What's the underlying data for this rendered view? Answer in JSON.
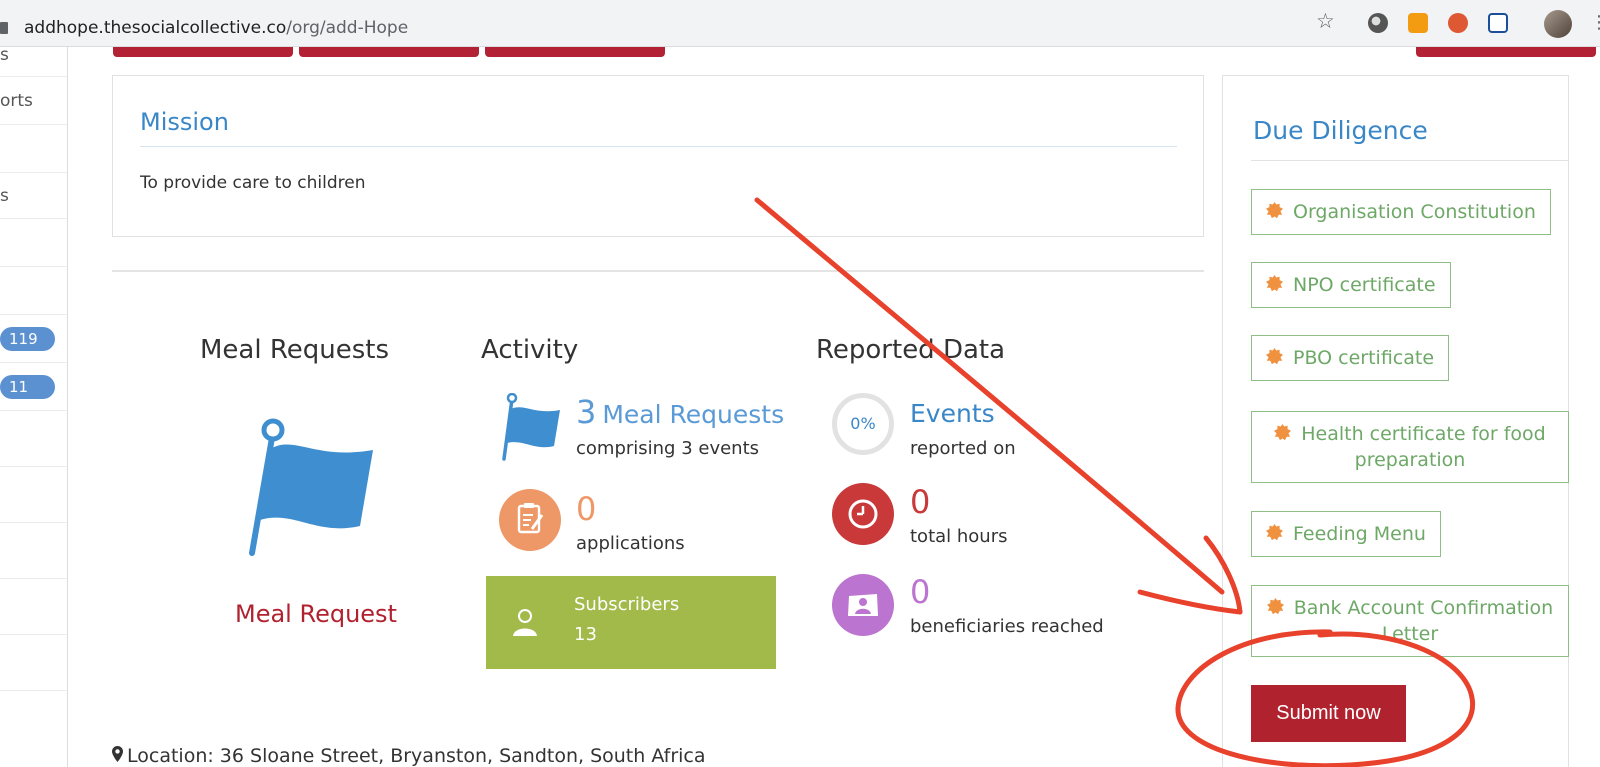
{
  "browser": {
    "url_host": "addhope.thesocialcollective.co",
    "url_path": "/org/add-Hope"
  },
  "sidebar": {
    "items": [
      {
        "label": "s"
      },
      {
        "label": "orts"
      },
      {
        "label": ""
      },
      {
        "label": "s"
      },
      {
        "label": ""
      },
      {
        "label": ""
      },
      {
        "label": "",
        "badge": "119"
      },
      {
        "label": "",
        "badge": "11"
      }
    ]
  },
  "mission": {
    "title": "Mission",
    "text": "To provide care to children"
  },
  "columns": {
    "meal_requests": {
      "title": "Meal Requests",
      "link": "Meal Request"
    },
    "activity": {
      "title": "Activity",
      "requests_count": "3",
      "requests_label": "Meal Requests",
      "requests_sub": "comprising 3 events",
      "applications_count": "0",
      "applications_sub": "applications",
      "subscribers_label": "Subscribers",
      "subscribers_count": "13"
    },
    "reported": {
      "title": "Reported Data",
      "events_percent": "0%",
      "events_label": "Events",
      "events_sub": "reported on",
      "hours_count": "0",
      "hours_sub": "total hours",
      "beneficiaries_count": "0",
      "beneficiaries_sub": "beneficiaries reached"
    }
  },
  "due_diligence": {
    "title": "Due Diligence",
    "items": [
      {
        "label": "Organisation Constitution"
      },
      {
        "label": "NPO certificate"
      },
      {
        "label": "PBO certificate"
      },
      {
        "label": "Health certificate for food preparation"
      },
      {
        "label": "Feeding Menu"
      },
      {
        "label": "Bank Account Confirmation Letter"
      }
    ],
    "submit_label": "Submit now"
  },
  "location": {
    "text": "Location: 36 Sloane Street, Bryanston, Sandton, South Africa"
  },
  "colors": {
    "primary_blue": "#3a87c8",
    "brand_red": "#b1222f",
    "success_green": "#6ea867",
    "subscribers_green": "#a2ba4a",
    "annotation_red": "#e8412c"
  }
}
